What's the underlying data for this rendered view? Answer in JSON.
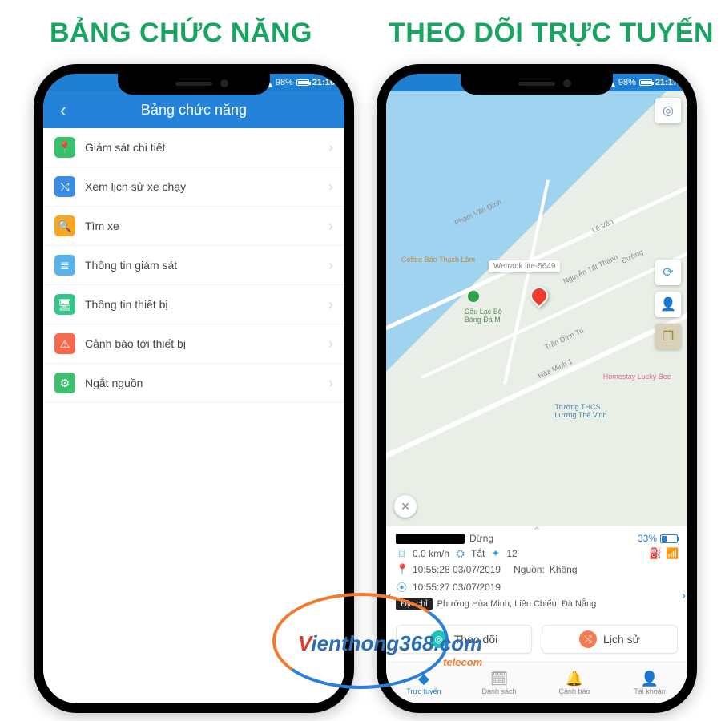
{
  "section_titles": {
    "left": "BẢNG CHỨC NĂNG",
    "right": "THEO DÕI TRỰC TUYẾN"
  },
  "status": {
    "battery": "98%",
    "time_left": "21:16",
    "time_right": "21:17"
  },
  "left_phone": {
    "titlebar": "Bảng chức năng",
    "menu": [
      {
        "icon": "pin-icon",
        "color": "col-green",
        "glyph": "📍",
        "label": "Giám sát chi tiết"
      },
      {
        "icon": "route-icon",
        "color": "col-blue",
        "glyph": "⤭",
        "label": "Xem lịch sử xe chạy"
      },
      {
        "icon": "search-icon",
        "color": "col-orange",
        "glyph": "🔍",
        "label": "Tìm xe"
      },
      {
        "icon": "list-icon",
        "color": "col-lblue",
        "glyph": "≣",
        "label": "Thông tin giám sát"
      },
      {
        "icon": "device-icon",
        "color": "col-teal",
        "glyph": "🖥",
        "label": "Thông tin thiết bị"
      },
      {
        "icon": "alert-icon",
        "color": "col-red",
        "glyph": "⚠",
        "label": "Cảnh báo tới thiết bị"
      },
      {
        "icon": "sliders-icon",
        "color": "col-green2",
        "glyph": "⚙",
        "label": "Ngắt nguồn"
      }
    ]
  },
  "right_phone": {
    "pin_tag": "Wetrack lite-5649",
    "map_labels": {
      "coffee": "Coffee Bảo Thạch Lâm",
      "club": "Câu Lạc Bộ\nBóng Đá M",
      "school": "Trường THCS\nLương Thế Vinh",
      "homestay": "Homestay Lucky Bee",
      "st1": "Phạm Văn Đình",
      "st2": "Nguyễn Tất Thành",
      "st3": "Trần Đình Tri",
      "st4": "Hòa Minh 1",
      "st5": "Lê Văn",
      "st6": "Đường"
    },
    "card": {
      "status": "Dừng",
      "battery_pct": "33%",
      "speed_val": "0.0 km/h",
      "acc_label": "Tắt",
      "sat_val": "12",
      "time1": "10:55:28 03/07/2019",
      "src_label": "Nguồn:",
      "src_val": "Không",
      "time2": "10:55:27 03/07/2019",
      "addr_label": "Địa chỉ",
      "addr": "Phường Hòa Minh, Liên Chiểu, Đà Nẵng"
    },
    "buttons": {
      "follow": "Theo dõi",
      "history": "Lịch sử"
    },
    "tabs": [
      {
        "icon": "◆",
        "label": "Trực tuyến",
        "active": true
      },
      {
        "icon": "🗓",
        "label": "Danh sách",
        "active": false
      },
      {
        "icon": "🔔",
        "label": "Cảnh báo",
        "active": false
      },
      {
        "icon": "👤",
        "label": "Tài khoản",
        "active": false
      }
    ]
  },
  "watermark": {
    "brand_v": "V",
    "brand_rest": "ienthong368.com",
    "sub": "telecom"
  }
}
